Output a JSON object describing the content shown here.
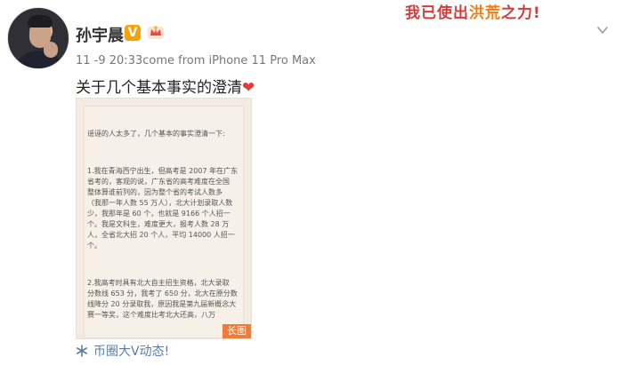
{
  "user": {
    "name": "孙宇晨",
    "verified_badge": "V",
    "crown_icon": "crown-icon",
    "avatar_icon": "avatar-icon"
  },
  "post": {
    "meta": "11 -9 20:33come from iPhone 11 Pro Max",
    "text": "关于几个基本事实的澄清",
    "text_heart": "❤",
    "long_image": {
      "badge": "长图",
      "lines": [
        "谣诬的人太多了，几个基本的事实澄清一下:",
        "1.我在青海西宁出生，但高考是 2007 年在广东",
        "省考的，客观的说，广东省的高考难度在全国",
        "整体算谁前列的，因为整个省的考试人数多",
        "（我那一年人数 55 万人），北大计划录取人数",
        "少，我那年是 60 个，也就是 9166 个人招一",
        "个。我是文科生，难度更大，报考人数 28 万",
        "人，全省北大招 20 个人，平均 14000 人招一",
        "个。",
        "2.我高考时具有北大自主招生资格，北大录取",
        "分数线 653 分，我考了 650 分，北大在原分数",
        "线降分 20 分录取我，原因我是第九届新概念大",
        "赛一等奖，这个难度比考北大还高，八万"
      ]
    }
  },
  "banner": {
    "text_a": "我已使出",
    "text_b": "洪荒",
    "text_c": "之力!"
  },
  "footer": {
    "label": "币圈大V动态!",
    "icon": "snowflake-icon"
  }
}
